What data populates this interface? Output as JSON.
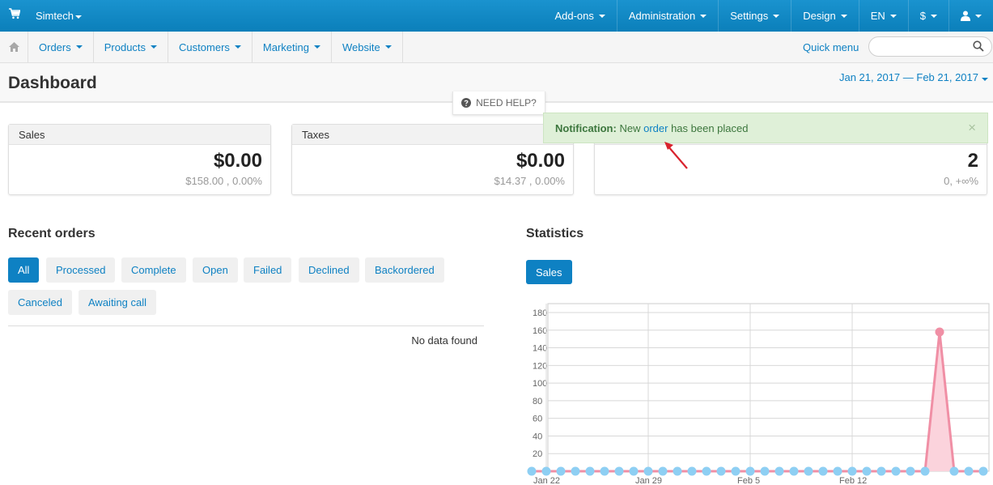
{
  "topbar": {
    "brand": "Simtech",
    "nav": [
      "Add-ons",
      "Administration",
      "Settings",
      "Design",
      "EN",
      "$"
    ]
  },
  "subnav": {
    "menu": [
      "Orders",
      "Products",
      "Customers",
      "Marketing",
      "Website"
    ],
    "quick_menu": "Quick menu",
    "search_placeholder": ""
  },
  "header": {
    "title": "Dashboard",
    "date_range": "Jan 21, 2017 — Feb 21, 2017"
  },
  "need_help": "NEED HELP?",
  "cards": [
    {
      "title": "Sales",
      "value": "$0.00",
      "sub": "$158.00 , 0.00%"
    },
    {
      "title": "Taxes",
      "value": "$0.00",
      "sub": "$14.37 , 0.00%"
    },
    {
      "title": "",
      "value": "2",
      "sub": "0, +∞%"
    }
  ],
  "notification": {
    "label": "Notification:",
    "text_before": "New",
    "link": "order",
    "text_after": "has been placed",
    "close": "×"
  },
  "recent_orders": {
    "title": "Recent orders",
    "tabs": [
      "All",
      "Processed",
      "Complete",
      "Open",
      "Failed",
      "Declined",
      "Backordered",
      "Canceled",
      "Awaiting call"
    ],
    "active_tab": "All",
    "empty": "No data found"
  },
  "statistics": {
    "title": "Statistics",
    "button": "Sales"
  },
  "colors": {
    "primary": "#0e81c3",
    "line": "#f08fa5",
    "fill": "#fbd3dc",
    "dots": "#8ecff3",
    "notif_bg": "#dff0d8"
  },
  "chart_data": {
    "type": "line",
    "y_ticks": [
      20,
      40,
      60,
      80,
      100,
      120,
      140,
      160,
      180
    ],
    "ylim": [
      0,
      180
    ],
    "x_ticks": [
      "Jan 22",
      "Jan 29",
      "Feb 5",
      "Feb 12"
    ],
    "x": [
      "Jan 21",
      "Jan 22",
      "Jan 23",
      "Jan 24",
      "Jan 25",
      "Jan 26",
      "Jan 27",
      "Jan 28",
      "Jan 29",
      "Jan 30",
      "Jan 31",
      "Feb 1",
      "Feb 2",
      "Feb 3",
      "Feb 4",
      "Feb 5",
      "Feb 6",
      "Feb 7",
      "Feb 8",
      "Feb 9",
      "Feb 10",
      "Feb 11",
      "Feb 12",
      "Feb 13",
      "Feb 14",
      "Feb 15",
      "Feb 16",
      "Feb 17",
      "Feb 18",
      "Feb 19",
      "Feb 20",
      "Feb 21"
    ],
    "values": [
      0,
      0,
      0,
      0,
      0,
      0,
      0,
      0,
      0,
      0,
      0,
      0,
      0,
      0,
      0,
      0,
      0,
      0,
      0,
      0,
      0,
      0,
      0,
      0,
      0,
      0,
      0,
      0,
      158,
      0,
      0,
      0
    ],
    "grid": true
  }
}
